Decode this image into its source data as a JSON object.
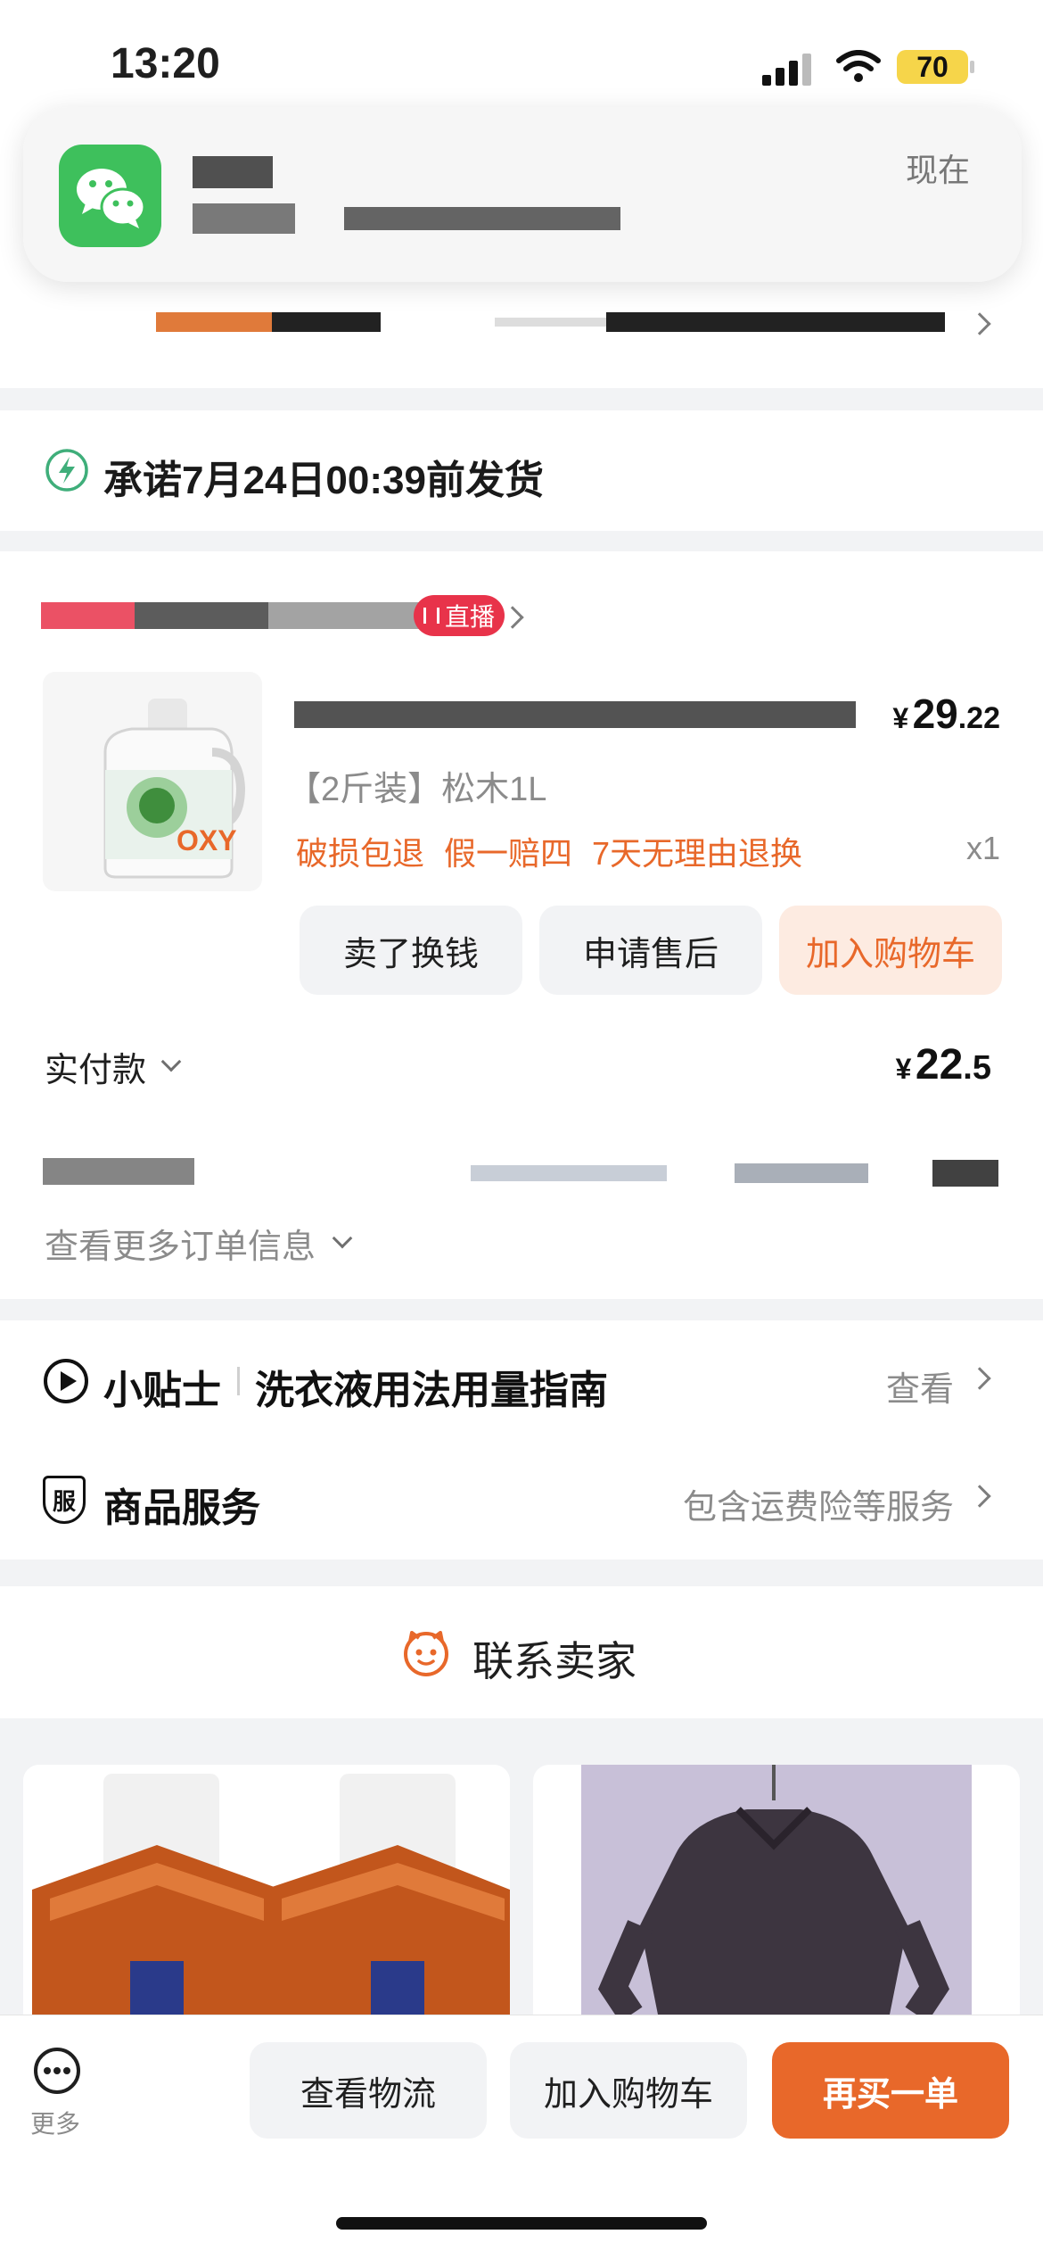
{
  "status_bar": {
    "time": "13:20",
    "battery": "70",
    "colors": {
      "battery_fill": "#f6d54a"
    }
  },
  "notification": {
    "app_icon": "wechat-icon",
    "time_label": "现在",
    "colors": {
      "wechat_green": "#3ec05c"
    }
  },
  "shipping": {
    "icon": "lightning-icon",
    "text": "承诺7月24日00:39前发货",
    "colors": {
      "icon_green": "#3fae7a"
    }
  },
  "order": {
    "live_badge": "直播",
    "product": {
      "price_symbol": "¥",
      "price_int": "29",
      "price_dec": ".22",
      "spec": "【2斤装】松木1L",
      "tags": [
        "破损包退",
        "假一赔四",
        "7天无理由退换"
      ],
      "quantity": "x1"
    },
    "actions": {
      "sell": "卖了换钱",
      "after_sale": "申请售后",
      "add_cart": "加入购物车"
    },
    "paid": {
      "label": "实付款",
      "symbol": "¥",
      "int": "22",
      "dec": ".5"
    },
    "more_info": "查看更多订单信息",
    "colors": {
      "accent_orange": "#e8682a",
      "live_red": "#e8334a"
    }
  },
  "tips": {
    "prefix": "小贴士",
    "title": "洗衣液用法用量指南",
    "action": "查看"
  },
  "services": {
    "title": "商品服务",
    "badge": "服",
    "summary": "包含运费险等服务"
  },
  "contact": {
    "label": "联系卖家"
  },
  "bottom_bar": {
    "more_label": "更多",
    "logistics": "查看物流",
    "add_cart": "加入购物车",
    "rebuy": "再买一单"
  }
}
